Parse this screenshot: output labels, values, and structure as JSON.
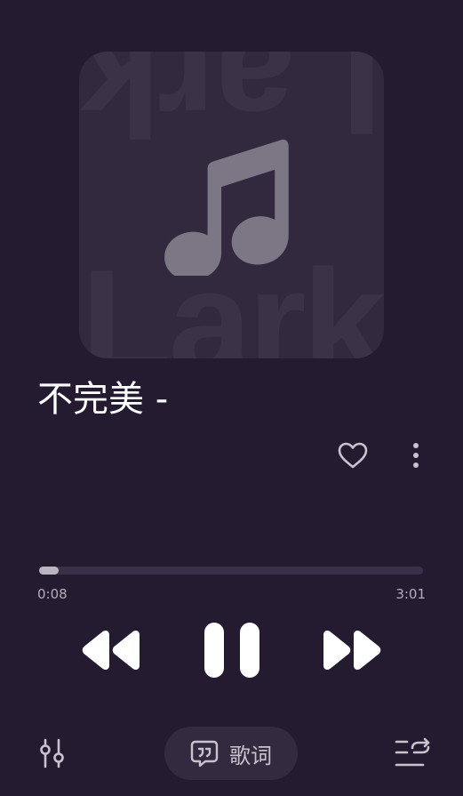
{
  "now_playing": {
    "artwork_wordmark": "Lark",
    "title": "不完美 -"
  },
  "progress": {
    "elapsed": "0:08",
    "total": "3:01",
    "fraction": 0.05
  },
  "controls": {
    "rewind_icon": "rewind-icon",
    "pause_icon": "pause-icon",
    "forward_icon": "fast-forward-icon"
  },
  "bottom_bar": {
    "lyrics_label": "歌词",
    "lyrics_icon": "lyrics-bubble-icon",
    "equalizer_icon": "equalizer-icon",
    "queue_icon": "queue-repeat-icon"
  },
  "colors": {
    "background": "#251b31",
    "artwork_bg": "#33293f",
    "note": "#7d7685",
    "progress_fill": "#b9b4c0",
    "track": "#3a3049",
    "pill": "#342a40"
  }
}
